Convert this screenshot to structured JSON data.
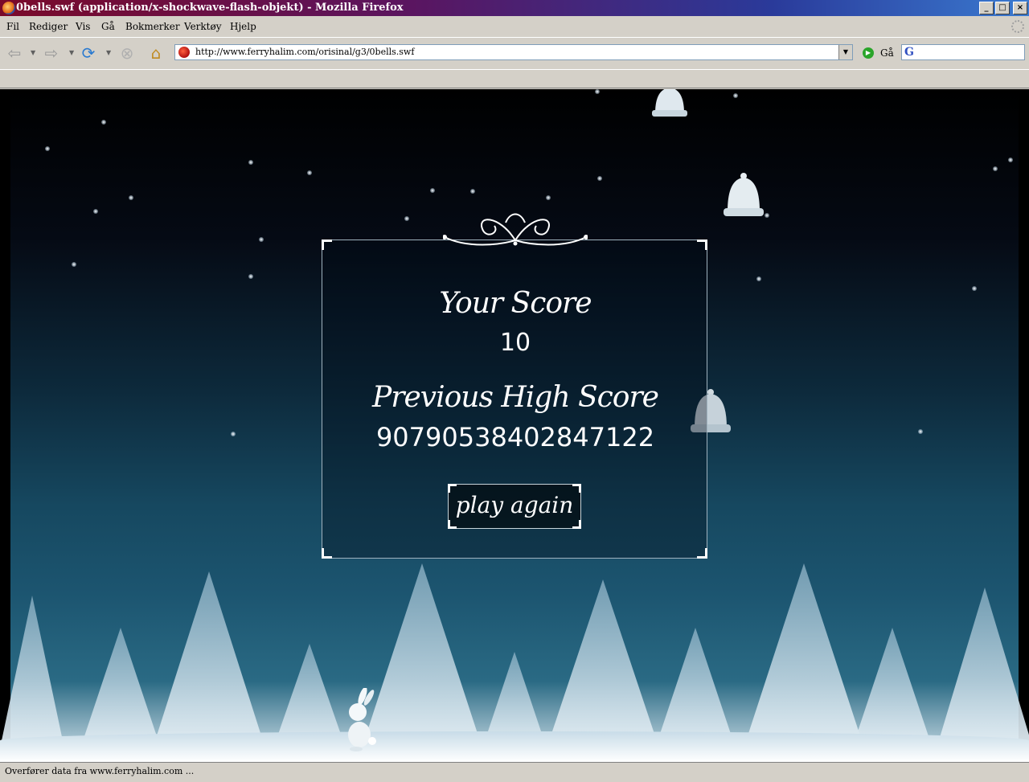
{
  "window": {
    "title": "0bells.swf (application/x-shockwave-flash-objekt) - Mozilla Firefox"
  },
  "menu": [
    "Fil",
    "Rediger",
    "Vis",
    "Gå",
    "Bokmerker",
    "Verktøy",
    "Hjelp"
  ],
  "toolbar": {
    "url": "http://www.ferryhalim.com/orisinal/g3/0bells.swf",
    "go_label": "Gå",
    "search_placeholder": ""
  },
  "game": {
    "score_label": "Your Score",
    "score_value": "10",
    "high_score_label": "Previous High Score",
    "high_score_value": "907905384028471​22",
    "play_again_label": "play again"
  },
  "status": {
    "text": "Overfører data fra www.ferryhalim.com ..."
  },
  "colors": {
    "title_bar_start": "#7a0a2a",
    "title_bar_end": "#3a7ad0",
    "chrome": "#d4d0c8"
  },
  "icons": [
    "firefox-icon",
    "minimize-icon",
    "maximize-icon",
    "close-icon",
    "back-icon",
    "forward-icon",
    "reload-icon",
    "stop-icon",
    "home-icon",
    "favicon-icon",
    "go-icon",
    "google-icon",
    "throbber-icon",
    "bell-icon",
    "bunny-icon"
  ]
}
